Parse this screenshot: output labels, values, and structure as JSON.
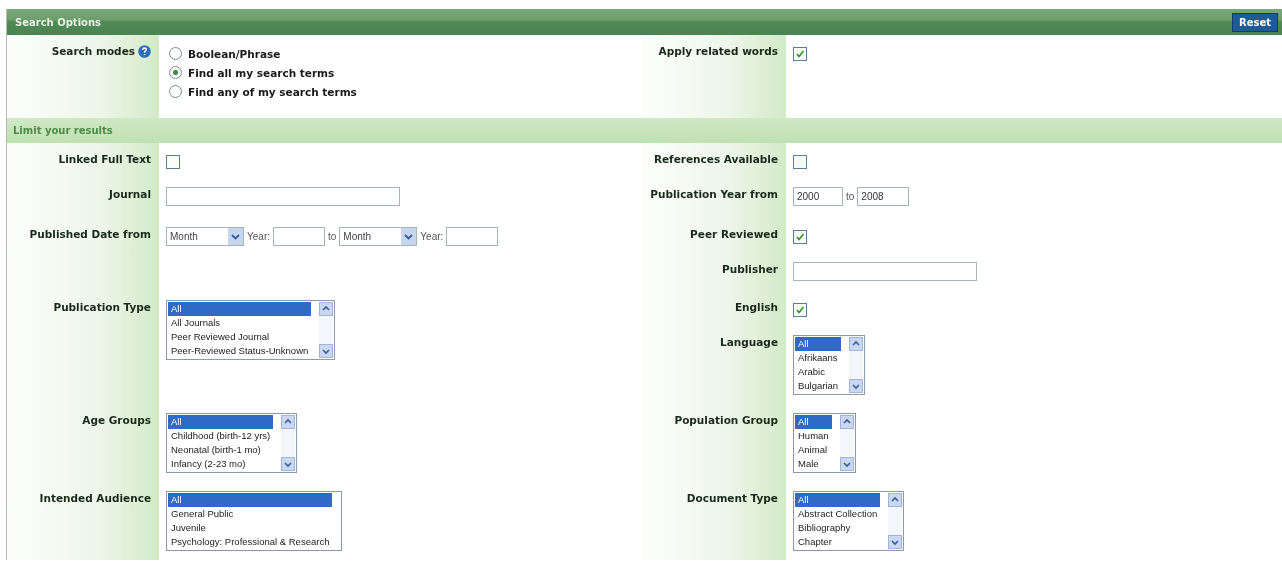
{
  "header": {
    "title": "Search Options",
    "reset": "Reset"
  },
  "top": {
    "left": [
      {
        "kind": "radios",
        "label": "Search modes",
        "help": true,
        "options": [
          {
            "label": "Boolean/Phrase",
            "selected": false
          },
          {
            "label": "Find all my search terms",
            "selected": true
          },
          {
            "label": "Find any of my search terms",
            "selected": false
          }
        ]
      }
    ],
    "right": [
      {
        "kind": "checkbox",
        "label": "Apply related words",
        "checked": true
      }
    ]
  },
  "limit_title": "Limit your results",
  "rows": [
    {
      "left": [
        {
          "kind": "checkbox",
          "label": "Linked Full Text",
          "checked": false
        }
      ],
      "right": [
        {
          "kind": "checkbox",
          "label": "References Available",
          "checked": false
        }
      ]
    },
    {
      "left": [
        {
          "kind": "text",
          "label": "Journal"
        }
      ],
      "right": [
        {
          "kind": "year_range",
          "label": "Publication Year from",
          "from": "2000",
          "to_label": "to",
          "to": "2008"
        }
      ]
    },
    {
      "left": [
        {
          "kind": "date_range",
          "label": "Published Date from",
          "from_month": "Month",
          "year_label": "Year:",
          "to_label": "to",
          "to_month": "Month",
          "to_year_label": "Year:"
        }
      ],
      "right": [
        {
          "kind": "checkbox",
          "label": "Peer Reviewed",
          "checked": true
        },
        {
          "kind": "text",
          "label": "Publisher"
        }
      ]
    },
    {
      "left": [
        {
          "kind": "listbox",
          "label": "Publication Type",
          "scrollbar": true,
          "items": [
            {
              "label": "All",
              "selected": true
            },
            {
              "label": "All Journals",
              "selected": false
            },
            {
              "label": "Peer Reviewed Journal",
              "selected": false
            },
            {
              "label": "Peer-Reviewed Status-Unknown",
              "selected": false
            }
          ]
        }
      ],
      "right": [
        {
          "kind": "checkbox",
          "label": "English",
          "checked": true
        },
        {
          "kind": "listbox",
          "label": "Language",
          "scrollbar": true,
          "items": [
            {
              "label": "All",
              "selected": true
            },
            {
              "label": "Afrikaans",
              "selected": false
            },
            {
              "label": "Arabic",
              "selected": false
            },
            {
              "label": "Bulgarian",
              "selected": false
            }
          ]
        }
      ]
    },
    {
      "left": [
        {
          "kind": "listbox",
          "label": "Age Groups",
          "scrollbar": true,
          "items": [
            {
              "label": "All",
              "selected": true
            },
            {
              "label": "Childhood (birth-12 yrs)",
              "selected": false
            },
            {
              "label": "Neonatal (birth-1 mo)",
              "selected": false
            },
            {
              "label": "Infancy (2-23 mo)",
              "selected": false
            }
          ]
        }
      ],
      "right": [
        {
          "kind": "listbox",
          "label": "Population Group",
          "scrollbar": true,
          "items": [
            {
              "label": "All",
              "selected": true
            },
            {
              "label": "Human",
              "selected": false
            },
            {
              "label": "Animal",
              "selected": false
            },
            {
              "label": "Male",
              "selected": false
            }
          ]
        }
      ]
    },
    {
      "left": [
        {
          "kind": "listbox",
          "label": "Intended Audience",
          "scrollbar": false,
          "items": [
            {
              "label": "All",
              "selected": true
            },
            {
              "label": "General Public",
              "selected": false
            },
            {
              "label": "Juvenile",
              "selected": false
            },
            {
              "label": "Psychology: Professional & Research",
              "selected": false
            }
          ]
        }
      ],
      "right": [
        {
          "kind": "listbox",
          "label": "Document Type",
          "scrollbar": true,
          "items": [
            {
              "label": "All",
              "selected": true
            },
            {
              "label": "Abstract Collection",
              "selected": false
            },
            {
              "label": "Bibliography",
              "selected": false
            },
            {
              "label": "Chapter",
              "selected": false
            }
          ]
        }
      ]
    }
  ]
}
